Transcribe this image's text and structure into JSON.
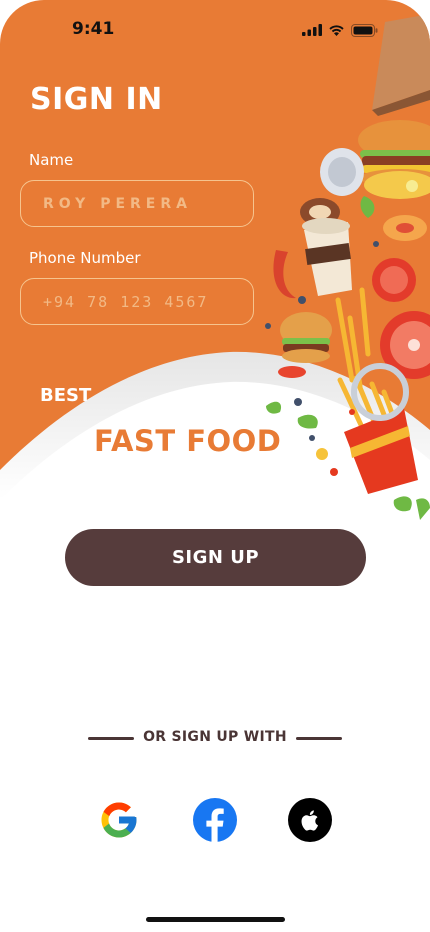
{
  "status_bar": {
    "time": "9:41"
  },
  "form": {
    "title": "SIGN IN",
    "name_label": "Name",
    "name_placeholder": "ROY PERERA",
    "phone_label": "Phone Number",
    "phone_placeholder": "+94 78 123 4567"
  },
  "tagline": {
    "line1": "BEST",
    "line2": "FAST FOOD"
  },
  "signup_button": "SIGN UP",
  "social": {
    "divider_text": "OR SIGN UP WITH",
    "providers": [
      "google-icon",
      "facebook-icon",
      "apple-icon"
    ]
  },
  "colors": {
    "primary_orange": "#E87B35",
    "button_brown": "#563C3C",
    "field_border": "#F6C48E"
  }
}
